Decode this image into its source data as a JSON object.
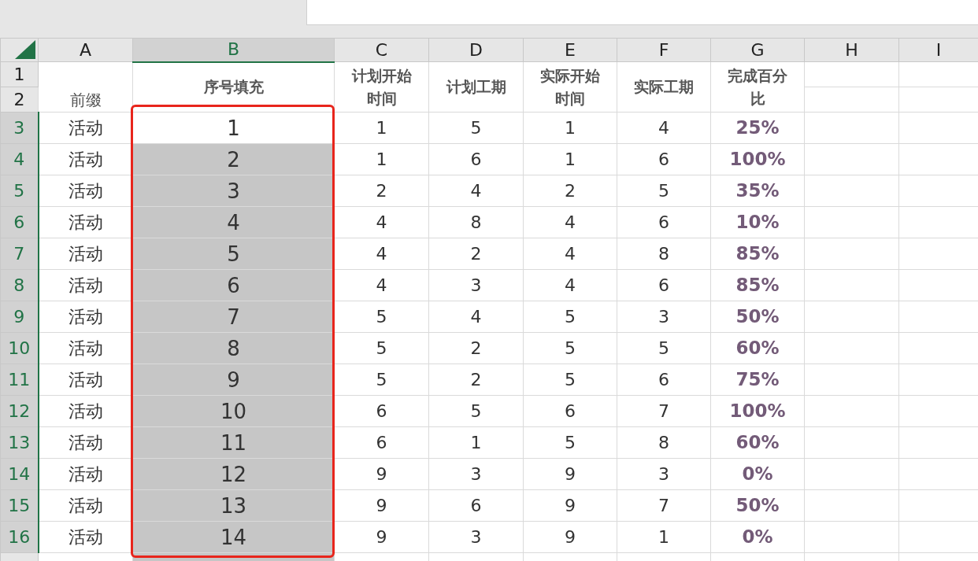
{
  "columns": [
    {
      "label": "A",
      "selected": false
    },
    {
      "label": "B",
      "selected": true
    },
    {
      "label": "C",
      "selected": false
    },
    {
      "label": "D",
      "selected": false
    },
    {
      "label": "E",
      "selected": false
    },
    {
      "label": "F",
      "selected": false
    },
    {
      "label": "G",
      "selected": false
    },
    {
      "label": "H",
      "selected": false
    },
    {
      "label": "I",
      "selected": false
    }
  ],
  "header_rows": [
    "1",
    "2"
  ],
  "headers": [
    "前缀",
    "序号填充",
    "计划开始时间",
    "计划工期",
    "实际开始时间",
    "实际工期",
    "完成百分比"
  ],
  "rows": [
    {
      "row": "3",
      "selected": true,
      "active": true,
      "cells": [
        "活动",
        "1",
        "1",
        "5",
        "1",
        "4",
        "25%"
      ]
    },
    {
      "row": "4",
      "selected": true,
      "active": false,
      "cells": [
        "活动",
        "2",
        "1",
        "6",
        "1",
        "6",
        "100%"
      ]
    },
    {
      "row": "5",
      "selected": true,
      "active": false,
      "cells": [
        "活动",
        "3",
        "2",
        "4",
        "2",
        "5",
        "35%"
      ]
    },
    {
      "row": "6",
      "selected": true,
      "active": false,
      "cells": [
        "活动",
        "4",
        "4",
        "8",
        "4",
        "6",
        "10%"
      ]
    },
    {
      "row": "7",
      "selected": true,
      "active": false,
      "cells": [
        "活动",
        "5",
        "4",
        "2",
        "4",
        "8",
        "85%"
      ]
    },
    {
      "row": "8",
      "selected": true,
      "active": false,
      "cells": [
        "活动",
        "6",
        "4",
        "3",
        "4",
        "6",
        "85%"
      ]
    },
    {
      "row": "9",
      "selected": true,
      "active": false,
      "cells": [
        "活动",
        "7",
        "5",
        "4",
        "5",
        "3",
        "50%"
      ]
    },
    {
      "row": "10",
      "selected": true,
      "active": false,
      "cells": [
        "活动",
        "8",
        "5",
        "2",
        "5",
        "5",
        "60%"
      ]
    },
    {
      "row": "11",
      "selected": true,
      "active": false,
      "cells": [
        "活动",
        "9",
        "5",
        "2",
        "5",
        "6",
        "75%"
      ]
    },
    {
      "row": "12",
      "selected": true,
      "active": false,
      "cells": [
        "活动",
        "10",
        "6",
        "5",
        "6",
        "7",
        "100%"
      ]
    },
    {
      "row": "13",
      "selected": true,
      "active": false,
      "cells": [
        "活动",
        "11",
        "6",
        "1",
        "5",
        "8",
        "60%"
      ]
    },
    {
      "row": "14",
      "selected": true,
      "active": false,
      "cells": [
        "活动",
        "12",
        "9",
        "3",
        "9",
        "3",
        "0%"
      ]
    },
    {
      "row": "15",
      "selected": true,
      "active": false,
      "cells": [
        "活动",
        "13",
        "9",
        "6",
        "9",
        "7",
        "50%"
      ]
    },
    {
      "row": "16",
      "selected": true,
      "active": false,
      "cells": [
        "活动",
        "14",
        "9",
        "3",
        "9",
        "1",
        "0%"
      ]
    }
  ]
}
